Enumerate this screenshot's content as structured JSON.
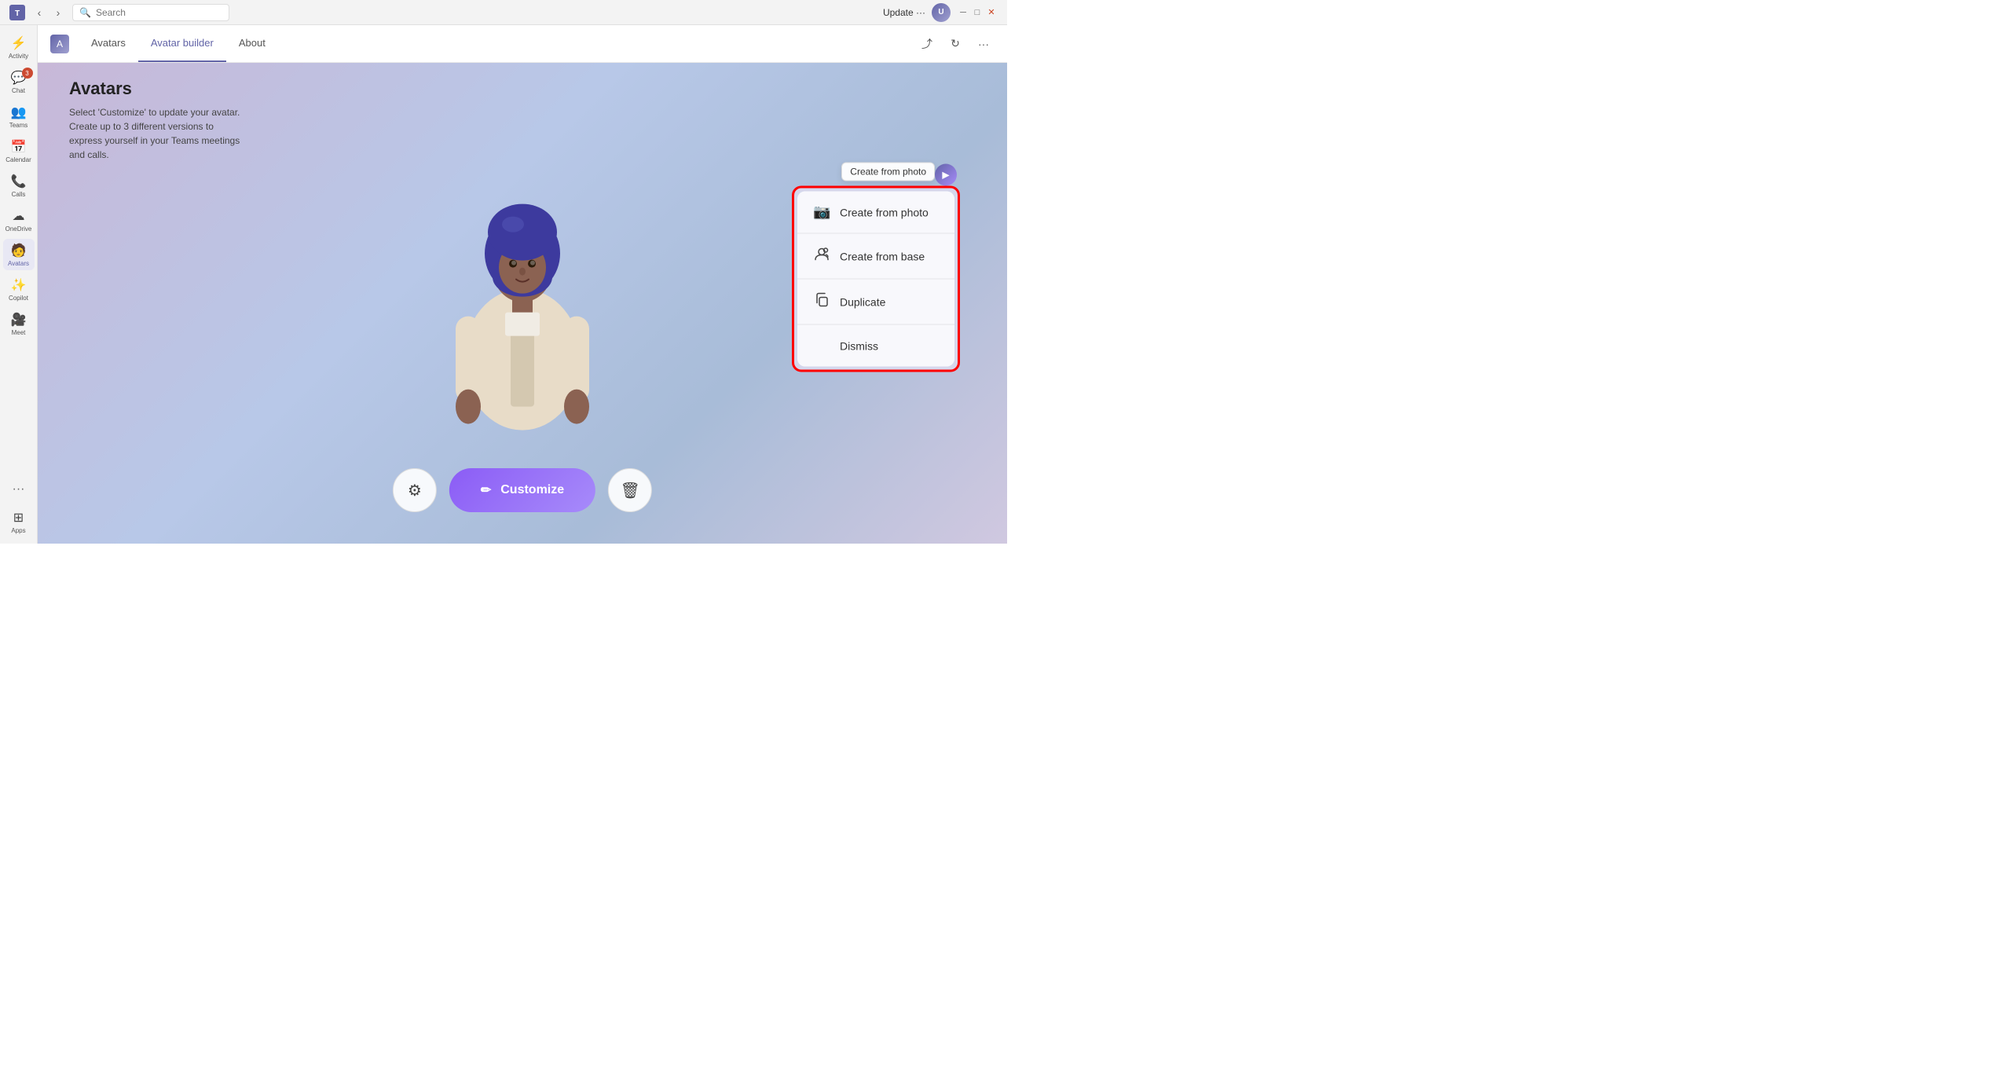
{
  "titlebar": {
    "update_label": "Update ···",
    "search_placeholder": "Search"
  },
  "sidebar": {
    "items": [
      {
        "id": "activity",
        "label": "Activity",
        "icon": "⚡",
        "badge": null
      },
      {
        "id": "chat",
        "label": "Chat",
        "icon": "💬",
        "badge": "3"
      },
      {
        "id": "teams",
        "label": "Teams",
        "icon": "👥",
        "badge": null
      },
      {
        "id": "calendar",
        "label": "Calendar",
        "icon": "📅",
        "badge": null
      },
      {
        "id": "calls",
        "label": "Calls",
        "icon": "📞",
        "badge": null
      },
      {
        "id": "onedrive",
        "label": "OneDrive",
        "icon": "☁",
        "badge": null
      },
      {
        "id": "avatars",
        "label": "Avatars",
        "icon": "🧑",
        "badge": null,
        "active": true
      },
      {
        "id": "copilot",
        "label": "Copilot",
        "icon": "✨",
        "badge": null
      },
      {
        "id": "meet",
        "label": "Meet",
        "icon": "🎥",
        "badge": null
      }
    ],
    "more_label": "···",
    "apps_label": "Apps"
  },
  "app_header": {
    "icon_label": "A",
    "tabs": [
      {
        "id": "avatars",
        "label": "Avatars",
        "active": false
      },
      {
        "id": "avatar_builder",
        "label": "Avatar builder",
        "active": true
      },
      {
        "id": "about",
        "label": "About",
        "active": false
      }
    ]
  },
  "page": {
    "title": "Avatars",
    "subtitle": "Select 'Customize' to update your avatar. Create up to 3 different versions to express yourself in your Teams meetings and calls."
  },
  "toolbar": {
    "settings_icon": "⚙",
    "customize_icon": "✏",
    "customize_label": "Customize",
    "delete_icon": "🗑"
  },
  "popup": {
    "tooltip_label": "Create from photo",
    "items": [
      {
        "id": "create_from_photo",
        "label": "Create from photo",
        "icon": "📷"
      },
      {
        "id": "create_from_base",
        "label": "Create from base",
        "icon": "👤"
      },
      {
        "id": "duplicate",
        "label": "Duplicate",
        "icon": "📋"
      },
      {
        "id": "dismiss",
        "label": "Dismiss",
        "icon": null
      }
    ]
  }
}
